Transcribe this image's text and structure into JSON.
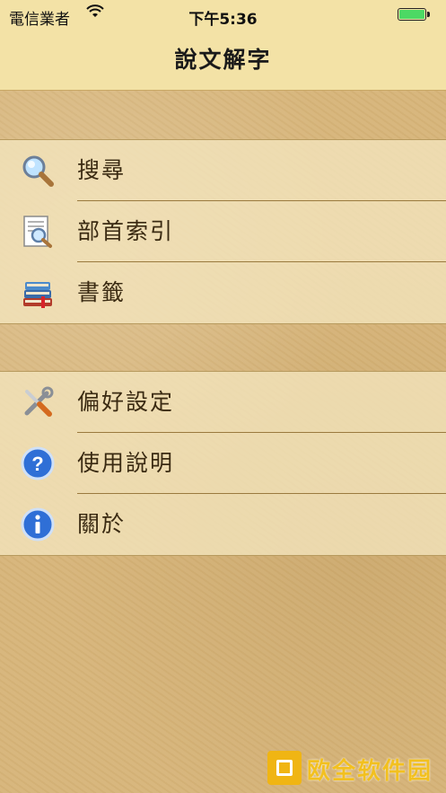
{
  "status_bar": {
    "carrier": "電信業者",
    "time": "下午5:36",
    "battery_level": 1.0,
    "icons": [
      "wifi-icon",
      "battery-icon"
    ]
  },
  "nav": {
    "title": "說文解字"
  },
  "menu": {
    "group1": [
      {
        "label": "搜尋",
        "icon": "magnifier-icon"
      },
      {
        "label": "部首索引",
        "icon": "radical-index-icon"
      },
      {
        "label": "書籤",
        "icon": "bookmark-books-icon"
      }
    ],
    "group2": [
      {
        "label": "偏好設定",
        "icon": "tools-icon"
      },
      {
        "label": "使用說明",
        "icon": "help-icon"
      },
      {
        "label": "關於",
        "icon": "info-icon"
      }
    ]
  },
  "colors": {
    "bar_background": "#f3e2a6",
    "paper_background": "#d7b57a",
    "row_text": "#3a2a12",
    "battery": "#4cd964",
    "watermark": "#f2c020"
  },
  "watermark": {
    "text": "欧全软件园"
  }
}
